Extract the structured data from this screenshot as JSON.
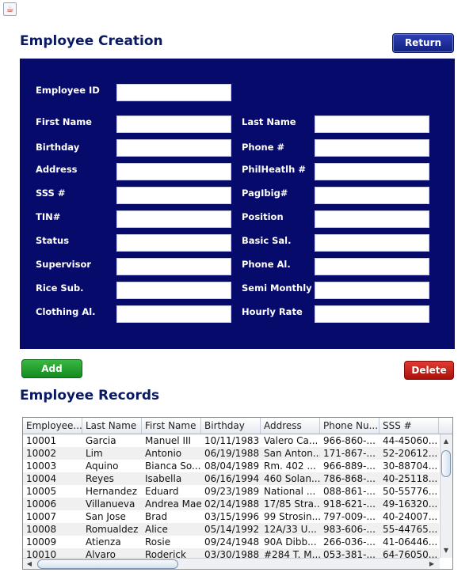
{
  "window": {
    "icon": "java-cup-icon"
  },
  "creation": {
    "title": "Employee Creation",
    "return_label": "Return",
    "fields": {
      "employee_id": "Employee ID",
      "first_name": "First Name",
      "last_name": "Last Name",
      "birthday": "Birthday",
      "phone": "Phone #",
      "address": "Address",
      "philhealth": "PhilHeatlh #",
      "sss": "SSS #",
      "pagibig": "PagIbig#",
      "tin": "TIN#",
      "position": "Position",
      "status": "Status",
      "basic_sal": "Basic Sal.",
      "supervisor": "Supervisor",
      "phone_al": "Phone Al.",
      "rice_sub": "Rice Sub.",
      "semi_monthly": "Semi Monthly",
      "clothing_al": "Clothing Al.",
      "hourly_rate": "Hourly Rate"
    },
    "add_label": "Add",
    "delete_label": "Delete"
  },
  "records": {
    "title": "Employee Records",
    "columns": [
      "Employee...",
      "Last Name",
      "First Name",
      "Birthday",
      "Address",
      "Phone Nu...",
      "SSS #"
    ],
    "rows": [
      [
        "10001",
        "Garcia",
        "Manuel III",
        "10/11/1983",
        "Valero Ca...",
        "966-860-...",
        "44-45060..."
      ],
      [
        "10002",
        "Lim",
        "Antonio",
        "06/19/1988",
        "San Anton...",
        "171-867-...",
        "52-20612..."
      ],
      [
        "10003",
        "Aquino",
        "Bianca So...",
        "08/04/1989",
        "Rm. 402 ...",
        "966-889-...",
        "30-88704..."
      ],
      [
        "10004",
        "Reyes",
        "Isabella",
        "06/16/1994",
        "460 Solan...",
        "786-868-...",
        "40-25118..."
      ],
      [
        "10005",
        "Hernandez",
        "Eduard",
        "09/23/1989",
        "National ...",
        "088-861-...",
        "50-55776..."
      ],
      [
        "10006",
        "Villanueva",
        "Andrea Mae",
        "02/14/1988",
        "17/85 Stra...",
        "918-621-...",
        "49-16320..."
      ],
      [
        "10007",
        "San Jose",
        "Brad",
        "03/15/1996",
        "99 Strosin...",
        "797-009-...",
        "40-24007..."
      ],
      [
        "10008",
        "Romualdez",
        "Alice",
        "05/14/1992",
        "12A/33 U...",
        "983-606-...",
        "55-44765..."
      ],
      [
        "10009",
        "Atienza",
        "Rosie",
        "09/24/1948",
        "90A Dibb...",
        "266-036-...",
        "41-06446..."
      ],
      [
        "10010",
        "Alvaro",
        "Roderick",
        "03/30/1988",
        "#284 T. M...",
        "053-381-...",
        "64-76050..."
      ]
    ]
  }
}
